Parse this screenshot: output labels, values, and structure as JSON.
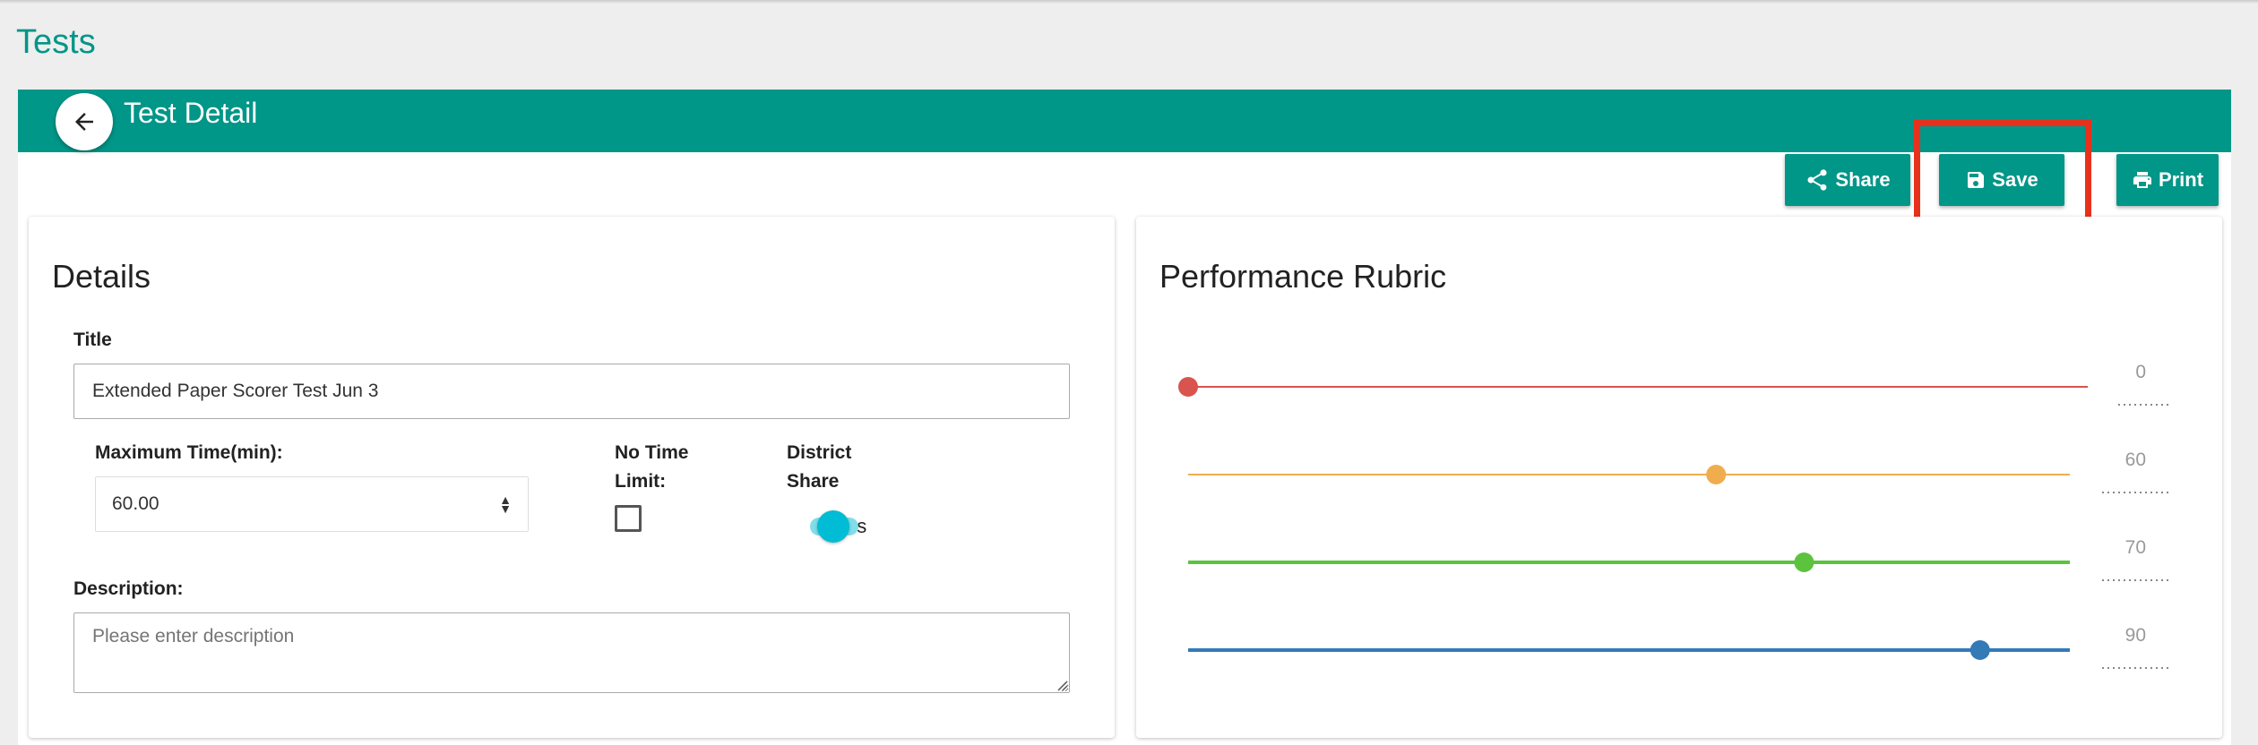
{
  "page": {
    "title": "Tests"
  },
  "header": {
    "title": "Test Detail",
    "back_icon": "arrow-left-icon"
  },
  "toolbar": {
    "share_label": "Share",
    "save_label": "Save",
    "print_label": "Print",
    "accent_color": "#009688",
    "highlight_color": "#e8311c"
  },
  "details": {
    "heading": "Details",
    "title_label": "Title",
    "title_value": "Extended Paper Scorer Test Jun 3",
    "max_time_label": "Maximum Time(min):",
    "max_time_value": "60.00",
    "no_time_label_1": "No Time",
    "no_time_label_2": "Limit:",
    "no_time_checked": false,
    "district_label_1": "District",
    "district_label_2": "Share",
    "district_share_on": true,
    "district_toggle_text": "es",
    "description_label": "Description:",
    "description_placeholder": "Please enter description",
    "description_value": ""
  },
  "rubric": {
    "heading": "Performance Rubric",
    "sliders": [
      {
        "value": 0,
        "label": "0",
        "color": "#d9534f"
      },
      {
        "value": 60,
        "label": "60",
        "color": "#f0ad4e"
      },
      {
        "value": 70,
        "label": "70",
        "color": "#5cc33f"
      },
      {
        "value": 90,
        "label": "90",
        "color": "#337ab7"
      }
    ]
  }
}
